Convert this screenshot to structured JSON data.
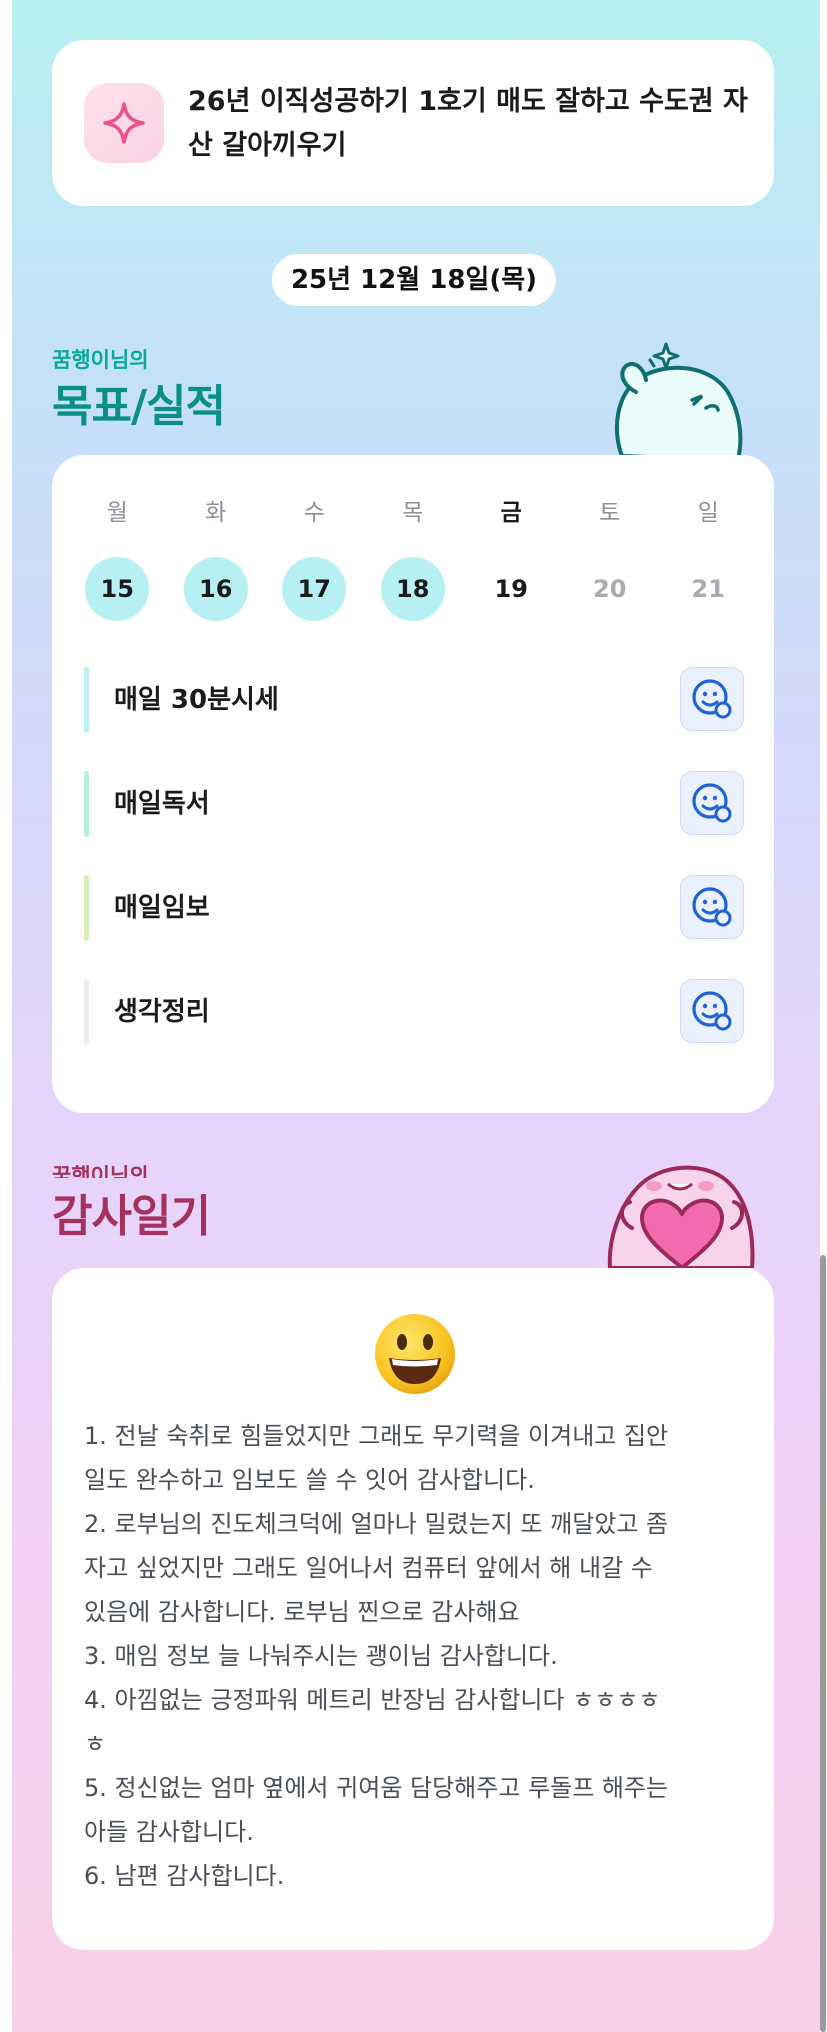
{
  "goal": {
    "icon": "sparkle-icon",
    "text": "26년 이직성공하기 1호기 매도 잘하고 수도권 자산 갈아끼우기"
  },
  "date_label": "25년 12월 18일(목)",
  "goals_section": {
    "subtitle": "꿈행이님의",
    "title": "목표/실적"
  },
  "calendar": {
    "days": [
      {
        "name": "월",
        "date": "15",
        "state": "done"
      },
      {
        "name": "화",
        "date": "16",
        "state": "done"
      },
      {
        "name": "수",
        "date": "17",
        "state": "done"
      },
      {
        "name": "목",
        "date": "18",
        "state": "done"
      },
      {
        "name": "금",
        "date": "19",
        "state": "today"
      },
      {
        "name": "토",
        "date": "20",
        "state": "future"
      },
      {
        "name": "일",
        "date": "21",
        "state": "future"
      }
    ]
  },
  "habits": [
    {
      "label": "매일 30분시세",
      "color": "#bdeff4",
      "icon": "smiley-add-icon"
    },
    {
      "label": "매일독서",
      "color": "#b7efdc",
      "icon": "smiley-add-icon"
    },
    {
      "label": "매일임보",
      "color": "#d4f2b8",
      "icon": "smiley-add-icon"
    },
    {
      "label": "생각정리",
      "color": "#eeeeee",
      "icon": "smiley-add-icon"
    }
  ],
  "gratitude_section": {
    "subtitle": "꿈행이님의",
    "title": "감사일기"
  },
  "diary": {
    "mood_icon": "grinning-face-emoji",
    "lines": [
      "1. 전날 숙취로 힘들었지만 그래도 무기력을 이겨내고 집안",
      "일도 완수하고 임보도 쓸 수 잇어 감사합니다.",
      "2. 로부님의 진도체크덕에 얼마나 밀렸는지 또 깨달았고 좀",
      "자고 싶었지만 그래도 일어나서 컴퓨터 앞에서 해 내갈 수",
      "있음에 감사합니다. 로부님 찐으로 감사해요",
      "3. 매임 정보 늘 나눠주시는 괭이님 감사합니다.",
      "4. 아낌없는 긍정파워 메트리 반장님 감사합니다 ㅎㅎㅎㅎ",
      "ㅎ",
      "5. 정신없는 엄마 옆에서 귀여움 담당해주고 루돌프 해주는",
      "아들 감사합니다.",
      "6. 남편 감사합니다."
    ]
  }
}
